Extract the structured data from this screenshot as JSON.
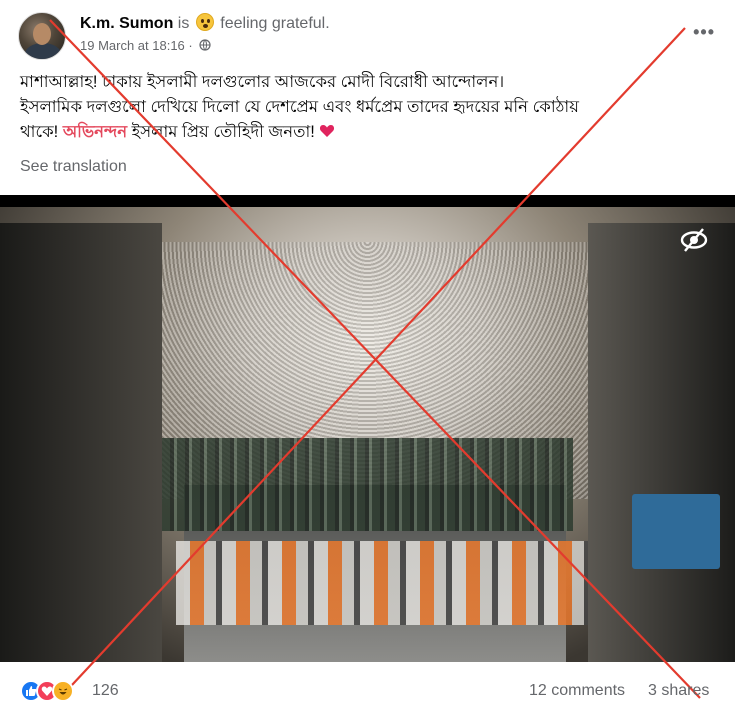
{
  "post": {
    "author": "K.m. Sumon",
    "activity_prefix": "is",
    "activity_text": "feeling grateful.",
    "timestamp": "19 March at 18:16",
    "dot_separator": "·",
    "more_label": "•••",
    "text_line1": "মাশাআল্লাহ! ঢাকায় ইসলামী দলগুলোর আজকের মোদী বিরোধী আন্দোলন।",
    "text_line2": "ইসলামিক দলগুলো দেখিয়ে দিলো যে দেশপ্রেম এবং ধর্মপ্রেম তাদের হৃদয়ের মনি কোঠায়",
    "text_line3_pre": "থাকে!",
    "text_highlight": "অভিনন্দন",
    "text_line3_post": "ইসলাম প্রিয় তৌহিদী জনতা!",
    "see_translation": "See translation"
  },
  "footer": {
    "reaction_count": "126",
    "comments": "12 comments",
    "shares": "3 shares"
  },
  "icons": {
    "globe": "globe-icon",
    "eye": "eye-icon",
    "heart": "heart-icon",
    "reactions": [
      "like-icon",
      "love-icon",
      "haha-icon"
    ]
  },
  "colors": {
    "text": "#050505",
    "secondary": "#65676b",
    "highlight": "#e4495d",
    "like": "#1877f2",
    "love": "#f33e58",
    "haha": "#f7b125",
    "cross_mark": "#e33b2e"
  }
}
